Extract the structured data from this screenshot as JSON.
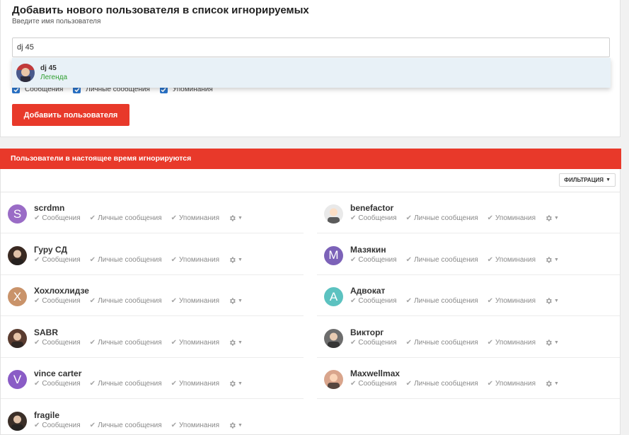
{
  "add_user": {
    "title": "Добавить нового пользователя в список игнорируемых",
    "description": "Введите имя пользователя",
    "input_value": "dj 45",
    "suggestion": {
      "name": "dj 45",
      "rank": "Легенда"
    },
    "options": [
      "Сообщения",
      "Личные сообщения",
      "Упоминания"
    ],
    "button_label": "Добавить пользователя"
  },
  "ignored": {
    "header": "Пользователи в настоящее время игнорируются",
    "filter_label": "ФИЛЬТРАЦИЯ",
    "option_labels": [
      "Сообщения",
      "Личные сообщения",
      "Упоминания"
    ],
    "users": [
      {
        "name": "scrdmn",
        "letter": "S",
        "color": "#9a6cc6"
      },
      {
        "name": "benefactor",
        "letter": "",
        "color": "#e9e9e9"
      },
      {
        "name": "Гуру СД",
        "letter": "",
        "color": "#3a2a22"
      },
      {
        "name": "Мазякин",
        "letter": "М",
        "color": "#7c62b8"
      },
      {
        "name": "Хохлохлидзе",
        "letter": "Х",
        "color": "#c9936a"
      },
      {
        "name": "Адвокат",
        "letter": "А",
        "color": "#5cc2c0"
      },
      {
        "name": "SABR",
        "letter": "",
        "color": "#5a3c30"
      },
      {
        "name": "Викторг",
        "letter": "",
        "color": "#6d6d6d"
      },
      {
        "name": "vince carter",
        "letter": "V",
        "color": "#8a5cc6"
      },
      {
        "name": "Maxwellmax",
        "letter": "",
        "color": "#d9a58c"
      },
      {
        "name": "fragile",
        "letter": "",
        "color": "#3b2f28"
      }
    ]
  }
}
